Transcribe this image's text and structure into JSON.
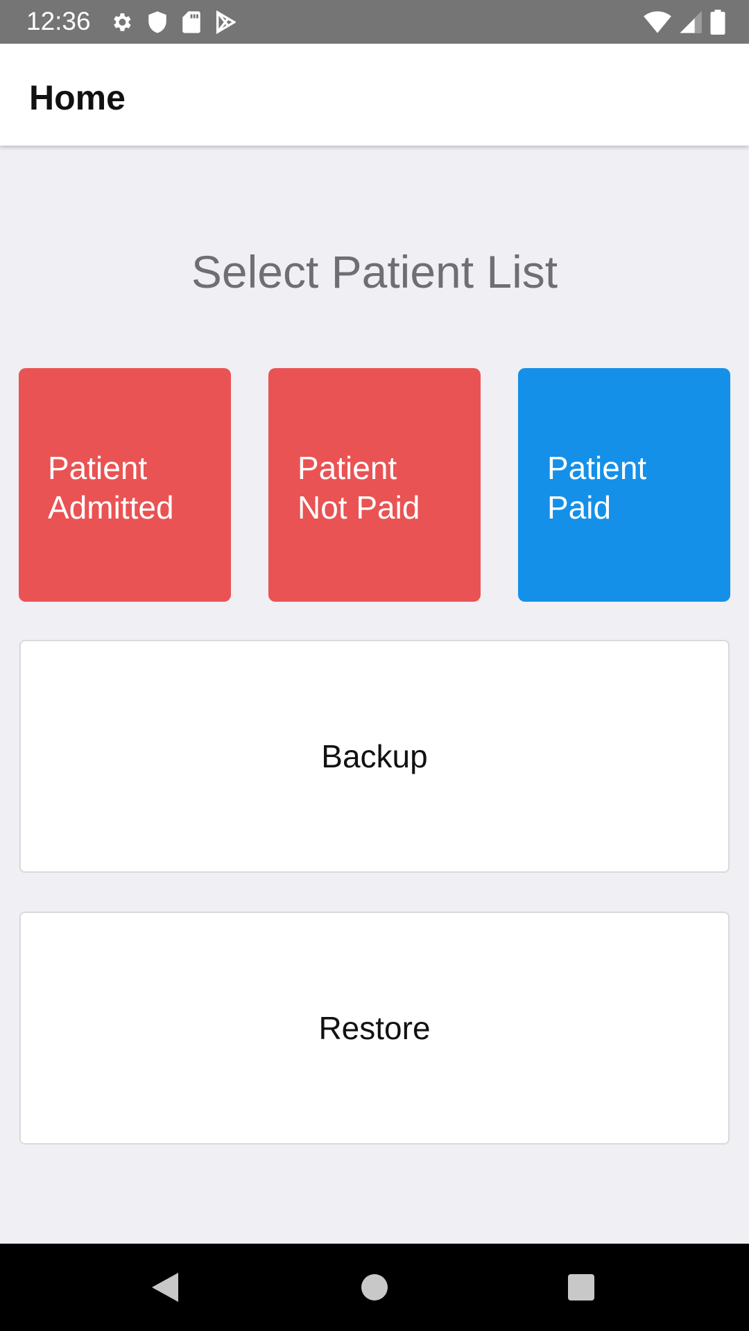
{
  "status_bar": {
    "time": "12:36",
    "left_icons": [
      "gear-icon",
      "shield-icon",
      "sd-card-icon",
      "play-store-icon"
    ],
    "right_icons": [
      "wifi-icon",
      "signal-icon",
      "battery-icon"
    ]
  },
  "app_bar": {
    "title": "Home"
  },
  "main": {
    "section_title": "Select Patient List",
    "tiles": [
      {
        "line1": "Patient",
        "line2": "Admitted",
        "color": "#e95354"
      },
      {
        "line1": "Patient",
        "line2": "Not Paid",
        "color": "#e95354"
      },
      {
        "line1": "Patient",
        "line2": "Paid",
        "color": "#1490e8"
      }
    ],
    "actions": [
      {
        "label": "Backup"
      },
      {
        "label": "Restore"
      }
    ]
  },
  "nav_bar": {
    "buttons": [
      "back-icon",
      "home-icon",
      "recents-icon"
    ]
  }
}
